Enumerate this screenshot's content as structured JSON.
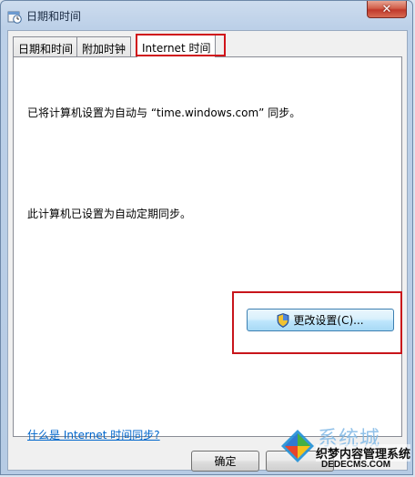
{
  "window": {
    "title": "日期和时间",
    "close_label": "✕"
  },
  "tabs": [
    {
      "label": "日期和时间",
      "active": false
    },
    {
      "label": "附加时钟",
      "active": false
    },
    {
      "label": "Internet 时间",
      "active": true
    }
  ],
  "panel": {
    "sync_status": "已将计算机设置为自动与 “time.windows.com” 同步。",
    "auto_sync": "此计算机已设置为自动定期同步。",
    "change_settings_label": "更改设置(C)...",
    "help_link": "什么是 Internet 时间同步?"
  },
  "footer": {
    "ok_label": "确定"
  },
  "watermark": {
    "brand_large": "系统城",
    "site_name": "织梦内容管理系统",
    "site_url": "DEDECMS.COM"
  },
  "colors": {
    "highlight_red": "#c8151b",
    "link_blue": "#0066cc"
  }
}
